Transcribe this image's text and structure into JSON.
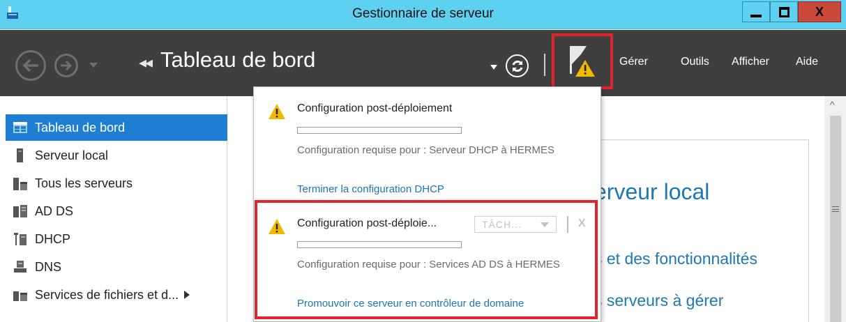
{
  "window": {
    "title": "Gestionnaire de serveur",
    "close_label": "X"
  },
  "toolbar": {
    "breadcrumb_arrows": "◂◂",
    "breadcrumb_title": "Tableau de bord",
    "menu": [
      "Gérer",
      "Outils",
      "Afficher",
      "Aide"
    ]
  },
  "sidebar": {
    "items": [
      {
        "label": "Tableau de bord",
        "icon": "dashboard-icon",
        "selected": true
      },
      {
        "label": "Serveur local",
        "icon": "local-server-icon"
      },
      {
        "label": "Tous les serveurs",
        "icon": "all-servers-icon"
      },
      {
        "label": "AD DS",
        "icon": "ad-ds-icon"
      },
      {
        "label": "DHCP",
        "icon": "dhcp-icon"
      },
      {
        "label": "DNS",
        "icon": "dns-icon"
      },
      {
        "label": "Services de fichiers et d...",
        "icon": "file-services-icon",
        "has_submenu": true
      }
    ]
  },
  "main": {
    "heading_partial": "erveur local",
    "link1_partial": "s et des fonctionnalités",
    "link2_partial": "s serveurs à gérer"
  },
  "notifications": [
    {
      "title": "Configuration post-déploiement",
      "progress": 0,
      "description": "Configuration requise pour : Serveur DHCP à HERMES",
      "action": "Terminer la configuration DHCP"
    },
    {
      "title": "Configuration post-déploie...",
      "task_label": "TÂCH...",
      "dismiss_label": "X",
      "progress": 0,
      "description": "Configuration requise pour : Services AD DS à HERMES",
      "action": "Promouvoir ce serveur en contrôleur de domaine"
    }
  ],
  "colors": {
    "titlebar": "#5ed0f0",
    "toolbar": "#3f3f3f",
    "selected": "#1f7ed2",
    "link": "#1d74b8",
    "highlight": "#e0242c",
    "warning": "#f2b800"
  }
}
